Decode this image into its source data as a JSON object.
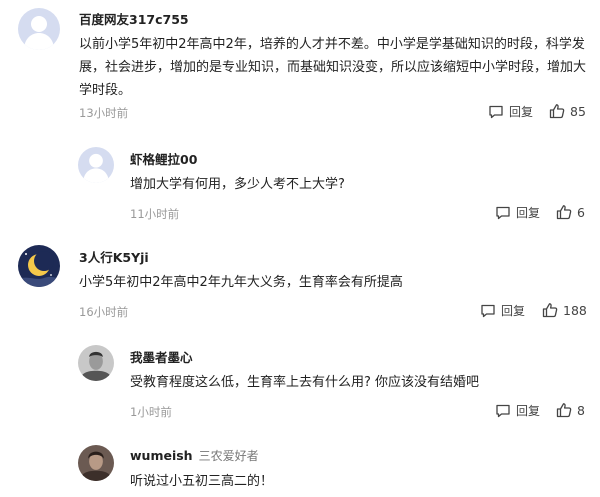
{
  "reply_label": "回复",
  "comments": [
    {
      "username": "百度网友317c755",
      "text": "以前小学5年初中2年高中2年，培养的人才并不差。中小学是学基础知识的时段，科学发展，社会进步，增加的是专业知识，而基础知识没变，所以应该缩短中小学时段，增加大学时段。",
      "time": "13小时前",
      "likes": "85",
      "avatar": "default-avatar"
    },
    {
      "username": "虾格鲤拉00",
      "text": "增加大学有何用，多少人考不上大学?",
      "time": "11小时前",
      "likes": "6",
      "avatar": "default-avatar"
    },
    {
      "username": "3人行K5Yji",
      "text": "小学5年初中2年高中2年九年大义务，生育率会有所提高",
      "time": "16小时前",
      "likes": "188",
      "avatar": "moon-night-avatar"
    },
    {
      "username": "我墨者墨心",
      "text": "受教育程度这么低，生育率上去有什么用? 你应该没有结婚吧",
      "time": "1小时前",
      "likes": "8",
      "avatar": "person-photo-avatar"
    },
    {
      "username": "wumeish",
      "user_tag": "三农爱好者",
      "text": "听说过小五初三高二的！",
      "avatar": "person-photo-avatar"
    }
  ]
}
